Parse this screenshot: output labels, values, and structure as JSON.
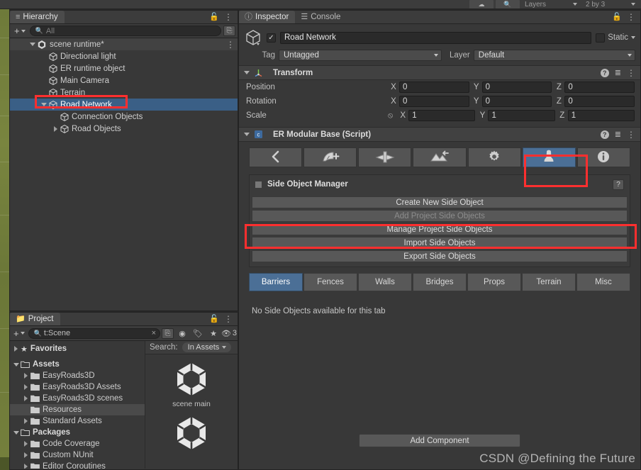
{
  "topbar": {
    "buttons": [
      "cloud-icon",
      "search-icon"
    ],
    "layers_label": "Layers",
    "layout_label": "2 by 3"
  },
  "hierarchy": {
    "tab_label": "Hierarchy",
    "lock_icon": "lock-icon",
    "menu_icon": "kebab-menu-icon",
    "add_label": "+",
    "search_placeholder": "All",
    "search_value": "",
    "items": [
      {
        "label": "scene runtime*",
        "depth": 0,
        "icon": "unity-scene-icon",
        "expander": "down",
        "selected": false,
        "is_scene": true
      },
      {
        "label": "Directional light",
        "depth": 1,
        "icon": "gameobject-icon",
        "expander": "none",
        "selected": false,
        "is_scene": false
      },
      {
        "label": "ER runtime object",
        "depth": 1,
        "icon": "gameobject-icon",
        "expander": "none",
        "selected": false,
        "is_scene": false
      },
      {
        "label": "Main Camera",
        "depth": 1,
        "icon": "gameobject-icon",
        "expander": "none",
        "selected": false,
        "is_scene": false
      },
      {
        "label": "Terrain",
        "depth": 1,
        "icon": "gameobject-icon",
        "expander": "none",
        "selected": false,
        "is_scene": false
      },
      {
        "label": "Road Network",
        "depth": 1,
        "icon": "gameobject-icon",
        "expander": "down",
        "selected": true,
        "is_scene": false
      },
      {
        "label": "Connection Objects",
        "depth": 2,
        "icon": "gameobject-icon",
        "expander": "none",
        "selected": false,
        "is_scene": false
      },
      {
        "label": "Road Objects",
        "depth": 2,
        "icon": "gameobject-icon",
        "expander": "right",
        "selected": false,
        "is_scene": false
      }
    ]
  },
  "project": {
    "tab_label": "Project",
    "add_label": "+",
    "search_value": "t:Scene",
    "clear_label": "×",
    "hidden_count": "3",
    "search_label": "Search:",
    "scope_label": "In Assets",
    "tree": [
      {
        "label": "Favorites",
        "depth": 0,
        "expander": "right",
        "icon": "star-icon",
        "bold": true,
        "selected": false
      },
      {
        "label": "",
        "depth": 0,
        "expander": "none",
        "icon": "spacer",
        "bold": false,
        "selected": false
      },
      {
        "label": "Assets",
        "depth": 0,
        "expander": "down",
        "icon": "folder-open-icon",
        "bold": true,
        "selected": false
      },
      {
        "label": "EasyRoads3D",
        "depth": 1,
        "expander": "right",
        "icon": "folder-icon",
        "bold": false,
        "selected": false
      },
      {
        "label": "EasyRoads3D Assets",
        "depth": 1,
        "expander": "right",
        "icon": "folder-icon",
        "bold": false,
        "selected": false
      },
      {
        "label": "EasyRoads3D scenes",
        "depth": 1,
        "expander": "right",
        "icon": "folder-icon",
        "bold": false,
        "selected": false
      },
      {
        "label": "Resources",
        "depth": 1,
        "expander": "none",
        "icon": "folder-icon",
        "bold": false,
        "selected": true
      },
      {
        "label": "Standard Assets",
        "depth": 1,
        "expander": "right",
        "icon": "folder-icon",
        "bold": false,
        "selected": false
      },
      {
        "label": "Packages",
        "depth": 0,
        "expander": "down",
        "icon": "folder-open-icon",
        "bold": true,
        "selected": false
      },
      {
        "label": "Code Coverage",
        "depth": 1,
        "expander": "right",
        "icon": "folder-icon",
        "bold": false,
        "selected": false
      },
      {
        "label": "Custom NUnit",
        "depth": 1,
        "expander": "right",
        "icon": "folder-icon",
        "bold": false,
        "selected": false
      },
      {
        "label": "Editor Coroutines",
        "depth": 1,
        "expander": "right",
        "icon": "folder-icon",
        "bold": false,
        "selected": false
      }
    ],
    "assets": [
      {
        "label": "scene main",
        "icon": "unity-scene-asset-icon"
      },
      {
        "label": "",
        "icon": "unity-scene-asset-icon"
      }
    ]
  },
  "inspector": {
    "tabs": [
      {
        "label": "Inspector",
        "icon": "info-icon",
        "active": true
      },
      {
        "label": "Console",
        "icon": "console-icon",
        "active": false
      }
    ],
    "lock_icon": "lock-icon",
    "menu_icon": "kebab-menu-icon",
    "gameobject": {
      "enabled": true,
      "name": "Road Network",
      "static_label": "Static",
      "static_checked": false,
      "tag_label": "Tag",
      "tag_value": "Untagged",
      "layer_label": "Layer",
      "layer_value": "Default"
    },
    "transform": {
      "title": "Transform",
      "rows": [
        {
          "label": "Position",
          "x": "0",
          "y": "0",
          "z": "0",
          "lock": false
        },
        {
          "label": "Rotation",
          "x": "0",
          "y": "0",
          "z": "0",
          "lock": false
        },
        {
          "label": "Scale",
          "x": "1",
          "y": "1",
          "z": "1",
          "lock": true
        }
      ],
      "axes": [
        "X",
        "Y",
        "Z"
      ]
    },
    "er_modular_base": {
      "title": "ER Modular Base (Script)",
      "toolbar": [
        {
          "icon": "back-arrow-icon",
          "active": false
        },
        {
          "icon": "add-road-icon",
          "active": false
        },
        {
          "icon": "crossing-icon",
          "active": false
        },
        {
          "icon": "terrain-tool-icon",
          "active": false
        },
        {
          "icon": "gear-icon",
          "active": false
        },
        {
          "icon": "side-object-icon",
          "active": true
        },
        {
          "icon": "info-circle-icon",
          "active": false
        }
      ],
      "side_object_manager": {
        "title": "Side Object Manager",
        "help_label": "?",
        "buttons": [
          {
            "label": "Create New Side Object",
            "disabled": false
          },
          {
            "label": "Add Project Side Objects",
            "disabled": true
          },
          {
            "label": "Manage Project Side Objects",
            "disabled": false
          },
          {
            "label": "Import Side Objects",
            "disabled": false
          },
          {
            "label": "Export Side Objects",
            "disabled": false
          }
        ]
      },
      "tabs": [
        {
          "label": "Barriers",
          "active": true
        },
        {
          "label": "Fences",
          "active": false
        },
        {
          "label": "Walls",
          "active": false
        },
        {
          "label": "Bridges",
          "active": false
        },
        {
          "label": "Props",
          "active": false
        },
        {
          "label": "Terrain",
          "active": false
        },
        {
          "label": "Misc",
          "active": false
        }
      ],
      "empty_message": "No Side Objects available for this tab"
    },
    "add_component_label": "Add Component"
  },
  "watermark": "CSDN @Defining the Future",
  "colors": {
    "accent_blue": "#4b6f96",
    "selection_blue": "#3a5f86",
    "annotation_red": "#ff2f2f",
    "panel_bg": "#383838",
    "header_bg": "#3c3c3c"
  }
}
